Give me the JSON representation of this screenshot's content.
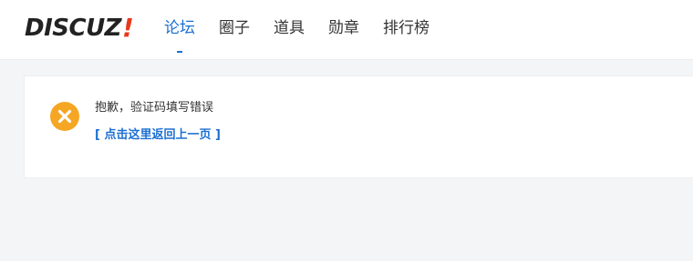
{
  "header": {
    "logo_text": "DISCUZ",
    "logo_mark": "!",
    "nav": [
      {
        "label": "论坛",
        "active": true
      },
      {
        "label": "圈子",
        "active": false
      },
      {
        "label": "道具",
        "active": false
      },
      {
        "label": "勋章",
        "active": false
      },
      {
        "label": "排行榜",
        "active": false
      }
    ]
  },
  "message": {
    "icon": "error-x-icon",
    "text": "抱歉，验证码填写错误",
    "back_link": "[ 点击这里返回上一页 ]"
  },
  "colors": {
    "accent": "#1c6fd1",
    "logo_mark": "#e8391b",
    "error_icon": "#f5a623",
    "page_bg": "#f4f5f7"
  }
}
